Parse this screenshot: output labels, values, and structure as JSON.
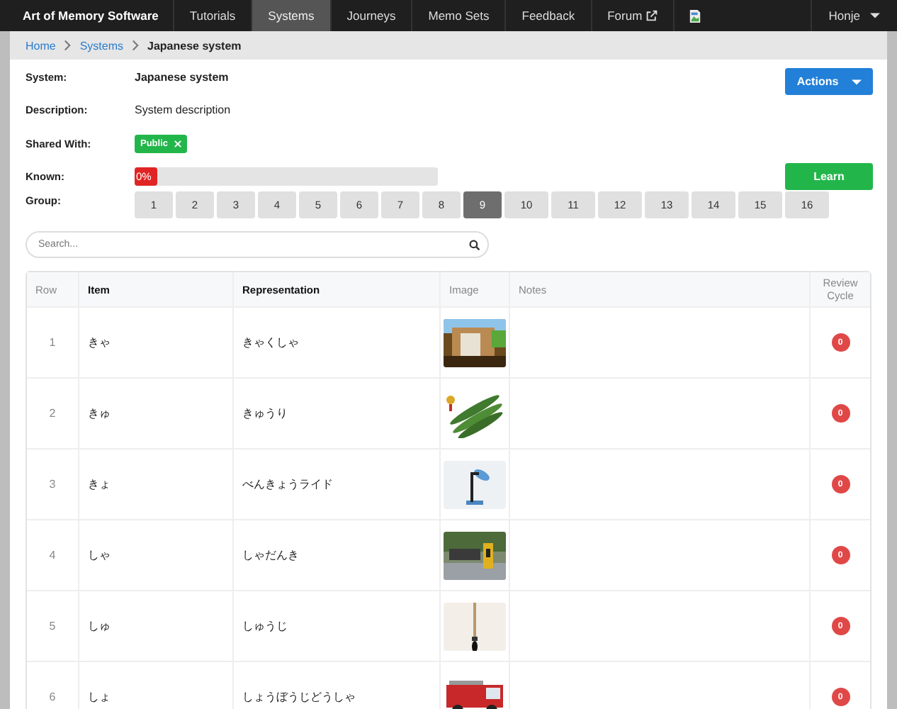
{
  "navbar": {
    "brand": "Art of Memory Software",
    "items": [
      {
        "label": "Tutorials",
        "selected": false,
        "external": false
      },
      {
        "label": "Systems",
        "selected": true,
        "external": false
      },
      {
        "label": "Journeys",
        "selected": false,
        "external": false
      },
      {
        "label": "Memo Sets",
        "selected": false,
        "external": false
      },
      {
        "label": "Feedback",
        "selected": false,
        "external": false
      },
      {
        "label": "Forum",
        "selected": false,
        "external": true
      }
    ],
    "user": "Honje"
  },
  "breadcrumb": [
    {
      "label": "Home",
      "link": true
    },
    {
      "label": "Systems",
      "link": true
    },
    {
      "label": "Japanese system",
      "link": false
    }
  ],
  "details": {
    "system_label": "System:",
    "system": "Japanese system",
    "description_label": "Description:",
    "description": "System description",
    "shared_label": "Shared With:",
    "shared": [
      "Public"
    ],
    "known_label": "Known:",
    "known": {
      "level": 0,
      "reading": "0%"
    },
    "group_label": "Group:"
  },
  "actions_button": "Actions",
  "learn_button": "Learn",
  "groups": [
    {
      "label": "1",
      "selected": false
    },
    {
      "label": "2",
      "selected": false
    },
    {
      "label": "3",
      "selected": false
    },
    {
      "label": "4",
      "selected": false
    },
    {
      "label": "5",
      "selected": false
    },
    {
      "label": "6",
      "selected": false
    },
    {
      "label": "7",
      "selected": false
    },
    {
      "label": "8",
      "selected": false
    },
    {
      "label": "9",
      "selected": true
    },
    {
      "label": "10",
      "selected": false
    },
    {
      "label": "11",
      "selected": false
    },
    {
      "label": "12",
      "selected": false
    },
    {
      "label": "13",
      "selected": false
    },
    {
      "label": "14",
      "selected": false
    },
    {
      "label": "15",
      "selected": false
    },
    {
      "label": "16",
      "selected": false
    }
  ],
  "search": {
    "placeholder": "Search..."
  },
  "table": {
    "columns": [
      "Row",
      "Item",
      "Representation",
      "Image",
      "Notes",
      "Review Cycle"
    ],
    "rows": [
      {
        "row": "1",
        "item": "きゃ",
        "representation": "きゃくしゃ",
        "review": "0"
      },
      {
        "row": "2",
        "item": "きゅ",
        "representation": "きゅうり",
        "review": "0"
      },
      {
        "row": "3",
        "item": "きょ",
        "representation": "べんきょうライド",
        "review": "0"
      },
      {
        "row": "4",
        "item": "しゃ",
        "representation": "しゃだんき",
        "review": "0"
      },
      {
        "row": "5",
        "item": "しゅ",
        "representation": "しゅうじ",
        "review": "0"
      },
      {
        "row": "6",
        "item": "しょ",
        "representation": "しょうぼうじどうしゃ",
        "review": "0"
      }
    ]
  }
}
